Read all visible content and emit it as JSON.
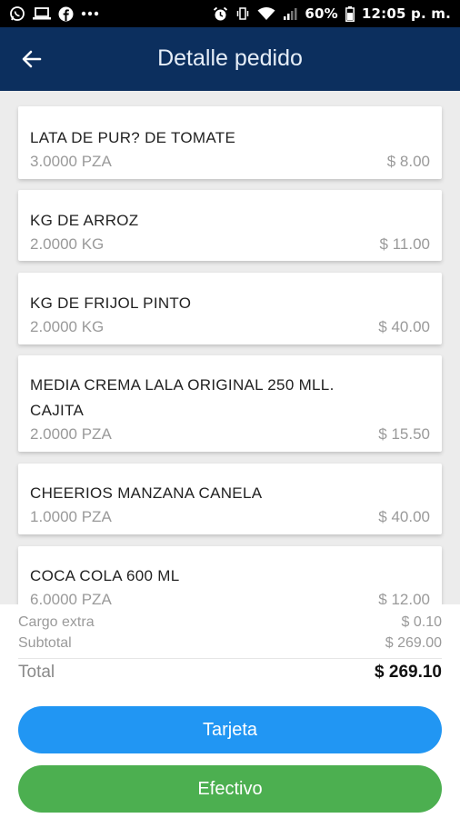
{
  "status_bar": {
    "battery": "60%",
    "time": "12:05 p. m.",
    "icons_left": [
      "whatsapp-icon",
      "laptop-icon",
      "facebook-icon",
      "more-icon"
    ],
    "icons_right": [
      "alarm-icon",
      "vibrate-icon",
      "wifi-icon",
      "signal-icon",
      "battery-icon"
    ]
  },
  "header": {
    "title": "Detalle pedido",
    "back_icon": "arrow-left-icon"
  },
  "items": [
    {
      "name": "LATA DE PUR? DE TOMATE",
      "qty": "3.0000 PZA",
      "price": "$ 8.00"
    },
    {
      "name": "KG DE ARROZ",
      "qty": "2.0000 KG",
      "price": "$ 11.00"
    },
    {
      "name": "KG DE FRIJOL PINTO",
      "qty": "2.0000 KG",
      "price": "$ 40.00"
    },
    {
      "name": "MEDIA CREMA LALA ORIGINAL 250 MLL.",
      "name2": "CAJITA",
      "qty": "2.0000 PZA",
      "price": "$ 15.50"
    },
    {
      "name": "CHEERIOS MANZANA CANELA",
      "qty": "1.0000 PZA",
      "price": "$ 40.00"
    },
    {
      "name": "COCA COLA 600 ML",
      "qty": "6.0000 PZA",
      "price": "$ 12.00"
    }
  ],
  "totals": {
    "extra_label": "Cargo extra",
    "extra_value": "$ 0.10",
    "subtotal_label": "Subtotal",
    "subtotal_value": "$ 269.00",
    "total_label": "Total",
    "total_value": "$ 269.10"
  },
  "buttons": {
    "card_label": "Tarjeta",
    "cash_label": "Efectivo"
  },
  "colors": {
    "header_bg": "#0c2f5e",
    "card_button": "#2196f3",
    "cash_button": "#4caf50"
  }
}
